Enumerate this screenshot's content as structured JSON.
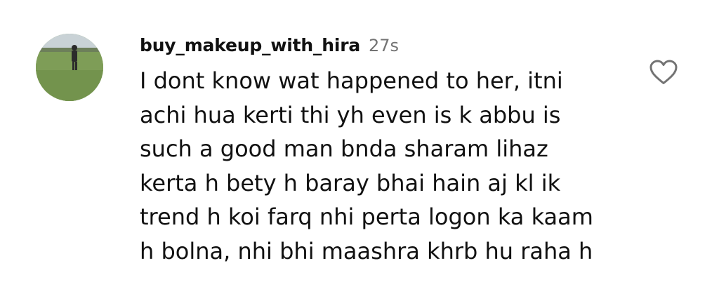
{
  "comment": {
    "username": "buy_makeup_with_hira",
    "time": "27s",
    "text": "I dont know wat happened to her, itni achi hua kerti thi yh even is k abbu is such a good man bnda sharam lihaz kerta h bety h baray bhai hain aj kl ik trend h koi farq nhi perta logon ka kaam h bolna, nhi bhi maashra khrb hu raha h",
    "avatar_icon": "profile-photo-person-on-grass",
    "like_icon": "heart-outline-icon"
  }
}
